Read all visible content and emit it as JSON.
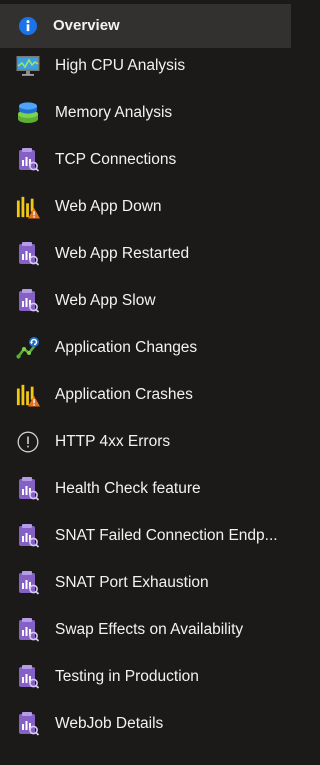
{
  "menu": {
    "items": [
      {
        "label": "Overview",
        "icon": "info-icon",
        "selected": true
      },
      {
        "label": "High CPU Analysis",
        "icon": "monitor-chart-icon"
      },
      {
        "label": "Memory Analysis",
        "icon": "memory-stack-icon"
      },
      {
        "label": "TCP Connections",
        "icon": "diagnostic-report-icon"
      },
      {
        "label": "Web App Down",
        "icon": "bar-chart-warning-icon"
      },
      {
        "label": "Web App Restarted",
        "icon": "diagnostic-report-icon"
      },
      {
        "label": "Web App Slow",
        "icon": "diagnostic-report-icon"
      },
      {
        "label": "Application Changes",
        "icon": "changes-graph-icon"
      },
      {
        "label": "Application Crashes",
        "icon": "bar-chart-warning-icon"
      },
      {
        "label": "HTTP 4xx Errors",
        "icon": "exclamation-circle-icon"
      },
      {
        "label": "Health Check feature",
        "icon": "diagnostic-report-icon"
      },
      {
        "label": "SNAT Failed Connection Endp...",
        "icon": "diagnostic-report-icon"
      },
      {
        "label": "SNAT Port Exhaustion",
        "icon": "diagnostic-report-icon"
      },
      {
        "label": "Swap Effects on Availability",
        "icon": "diagnostic-report-icon"
      },
      {
        "label": "Testing in Production",
        "icon": "diagnostic-report-icon"
      },
      {
        "label": "WebJob Details",
        "icon": "diagnostic-report-icon"
      }
    ]
  },
  "colors": {
    "background": "#1b1a19",
    "selected_background": "#323130",
    "text": "#f3f2f1",
    "info_blue": "#1a73e8",
    "report_purple": "#8661c5",
    "bar_yellow": "#f2c811",
    "warning_orange": "#e8711c"
  }
}
